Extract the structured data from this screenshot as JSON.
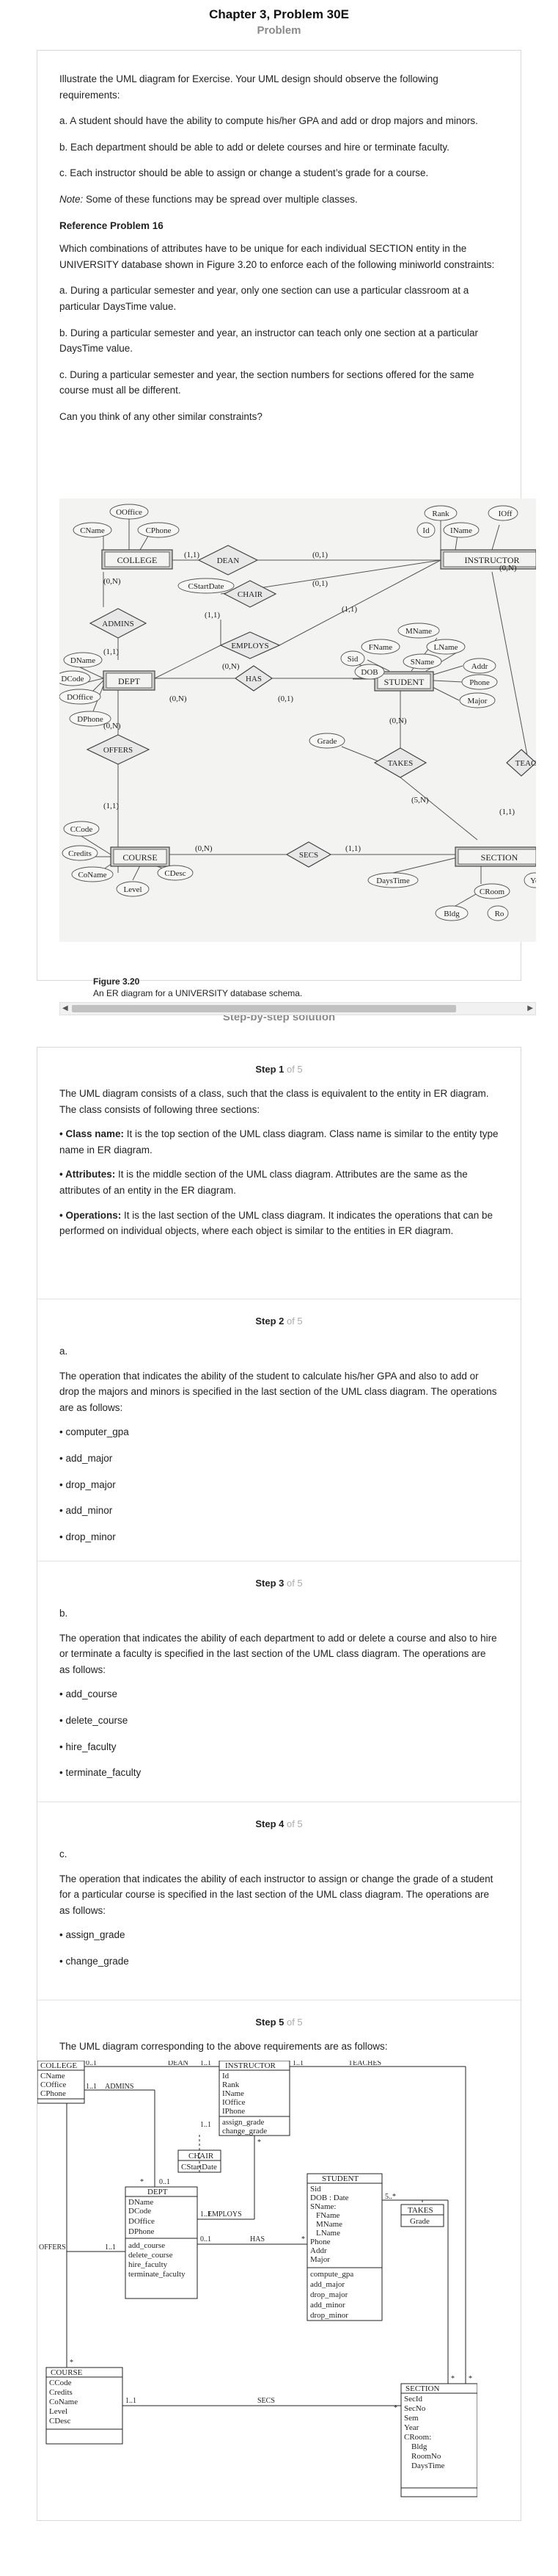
{
  "header": {
    "chapter_title": "Chapter 3, Problem 30E",
    "problem_label": "Problem",
    "solution_label": "Step-by-step solution"
  },
  "problem": {
    "intro": "Illustrate the UML diagram for Exercise. Your UML design should observe the following requirements:",
    "req_a": "a. A student should have the ability to compute his/her GPA and add or drop majors and minors.",
    "req_b": "b. Each department should be able to add or delete courses and hire or terminate faculty.",
    "req_c": "c. Each instructor should be able to assign or change a student’s grade for a course.",
    "note_label": "Note:",
    "note_text": " Some of these functions may be spread over multiple classes.",
    "ref_title": "Reference Problem 16",
    "ref_text": "Which combinations of attributes have to be unique for each individual SECTION entity in the UNIVERSITY database shown in Figure 3.20 to enforce each of the following miniworld constraints:",
    "ref_a": "a. During a particular semester and year, only one section can use a particular classroom at a particular DaysTime value.",
    "ref_b": "b. During a particular semester and year, an instructor can teach only one section at a particular DaysTime value.",
    "ref_c": "c. During a particular semester and year, the section numbers for sections offered for the same course must all be different.",
    "question": "Can you think of any other similar constraints?",
    "figure_number": "Figure 3.20",
    "figure_caption": "An ER diagram for a UNIVERSITY database schema."
  },
  "er": {
    "entities": [
      "COLLEGE",
      "INSTRUCTOR",
      "DEPT",
      "STUDENT",
      "COURSE",
      "SECTION"
    ],
    "relationships": [
      "DEAN",
      "CHAIR",
      "ADMINS",
      "EMPLOYS",
      "HAS",
      "OFFERS",
      "TAKES",
      "SECS",
      "TEAC"
    ],
    "attributes": [
      "OOffice",
      "CName",
      "CPhone",
      "CStartDate",
      "Rank",
      "Id",
      "IName",
      "IOff",
      "MName",
      "FName",
      "LName",
      "SName",
      "Sid",
      "DOB",
      "Addr",
      "Phone",
      "Major",
      "Grade",
      "DName",
      "DCode",
      "DOffice",
      "DPhone",
      "CCode",
      "Credits",
      "CoName",
      "CDesc",
      "Level",
      "DaysTime",
      "CRoom",
      "Bldg",
      "Ro",
      "Ye"
    ],
    "cardinalities": [
      "(1,1)",
      "(0,1)",
      "(0,N)",
      "(1,N)",
      "(5,N)"
    ]
  },
  "steps": [
    {
      "num": "Step 1",
      "of": " of 5",
      "p1": "The UML diagram consists of a class, such that the class is equivalent to the entity in ER diagram. The class consists of following three sections:",
      "b1_label": "• Class name:",
      "b1_text": " It is the top section of the UML class diagram. Class name is similar to the entity type name in ER diagram.",
      "b2_label": "• Attributes:",
      "b2_text": " It is the middle section of the UML class diagram. Attributes are the same as the attributes of an entity in the ER diagram.",
      "b3_label": "• Operations:",
      "b3_text": " It is the last section of the UML class diagram. It indicates the operations that can be performed on individual objects, where each object is similar to the entities in ER diagram."
    },
    {
      "num": "Step 2",
      "of": " of 5",
      "label": "a.",
      "p1": "The operation that indicates the ability of the student to calculate his/her GPA and also to add or drop the majors and minors is specified in the last section of the UML class diagram. The operations are as follows:",
      "items": [
        "• computer_gpa",
        "• add_major",
        "• drop_major",
        "• add_minor",
        "• drop_minor"
      ]
    },
    {
      "num": "Step 3",
      "of": " of 5",
      "label": "b.",
      "p1": "The operation that indicates the ability of each department to add or delete a course and also to hire or terminate a faculty is specified in the last section of the UML class diagram. The operations are as follows:",
      "items": [
        "• add_course",
        "• delete_course",
        "• hire_faculty",
        "• terminate_faculty"
      ]
    },
    {
      "num": "Step 4",
      "of": " of 5",
      "label": "c.",
      "p1": "The operation that indicates the ability of each instructor to assign or change the grade of a student for a particular course is specified in the last section of the UML class diagram. The operations are as follows:",
      "items": [
        "• assign_grade",
        "• change_grade"
      ]
    },
    {
      "num": "Step 5",
      "of": " of 5",
      "p1": "The UML diagram corresponding to the above requirements are as follows:"
    }
  ],
  "uml": {
    "college": {
      "name": "COLLEGE",
      "attrs": [
        "CName",
        "COffice",
        "CPhone"
      ]
    },
    "instructor": {
      "name": "INSTRUCTOR",
      "attrs": [
        "Id",
        "Rank",
        "IName",
        "IOffice",
        "IPhone"
      ],
      "ops": [
        "assign_grade",
        "change_grade"
      ]
    },
    "chair": {
      "name": "CHAIR",
      "attrs": [
        "CStartDate"
      ]
    },
    "dept": {
      "name": "DEPT",
      "attrs": [
        "DName",
        "DCode",
        "DOffice",
        "DPhone"
      ],
      "ops": [
        "add_course",
        "delete_course",
        "hire_faculty",
        "terminate_faculty"
      ]
    },
    "student": {
      "name": "STUDENT",
      "attrs": [
        "Sid",
        "DOB : Date",
        "SName:",
        "FName",
        "MName",
        "LName",
        "Phone",
        "Addr",
        "Major"
      ],
      "ops": [
        "compute_gpa",
        "add_major",
        "drop_major",
        "add_minor",
        "drop_minor"
      ]
    },
    "takes": {
      "name": "TAKES",
      "attrs": [
        "Grade"
      ]
    },
    "course": {
      "name": "COURSE",
      "attrs": [
        "CCode",
        "Credits",
        "CoName",
        "Level",
        "CDesc"
      ]
    },
    "section": {
      "name": "SECTION",
      "attrs": [
        "SecId",
        "SecNo",
        "Sem",
        "Year",
        "CRoom:",
        "Bldg",
        "RoomNo",
        "DaysTime"
      ]
    },
    "assoc": {
      "dean": "DEAN",
      "teaches": "TEACHES",
      "admins": "ADMINS",
      "employs": "EMPLOYS",
      "has": "HAS",
      "offers": "OFFERS",
      "secs": "SECS"
    },
    "mult": {
      "m01": "0..1",
      "m11": "1..1",
      "star": "*",
      "m5": "5..*"
    }
  },
  "colors": {
    "card_border": "#d8d8d8",
    "muted": "#8a8a8a",
    "er_entity_fill": "#d0d0d0"
  }
}
